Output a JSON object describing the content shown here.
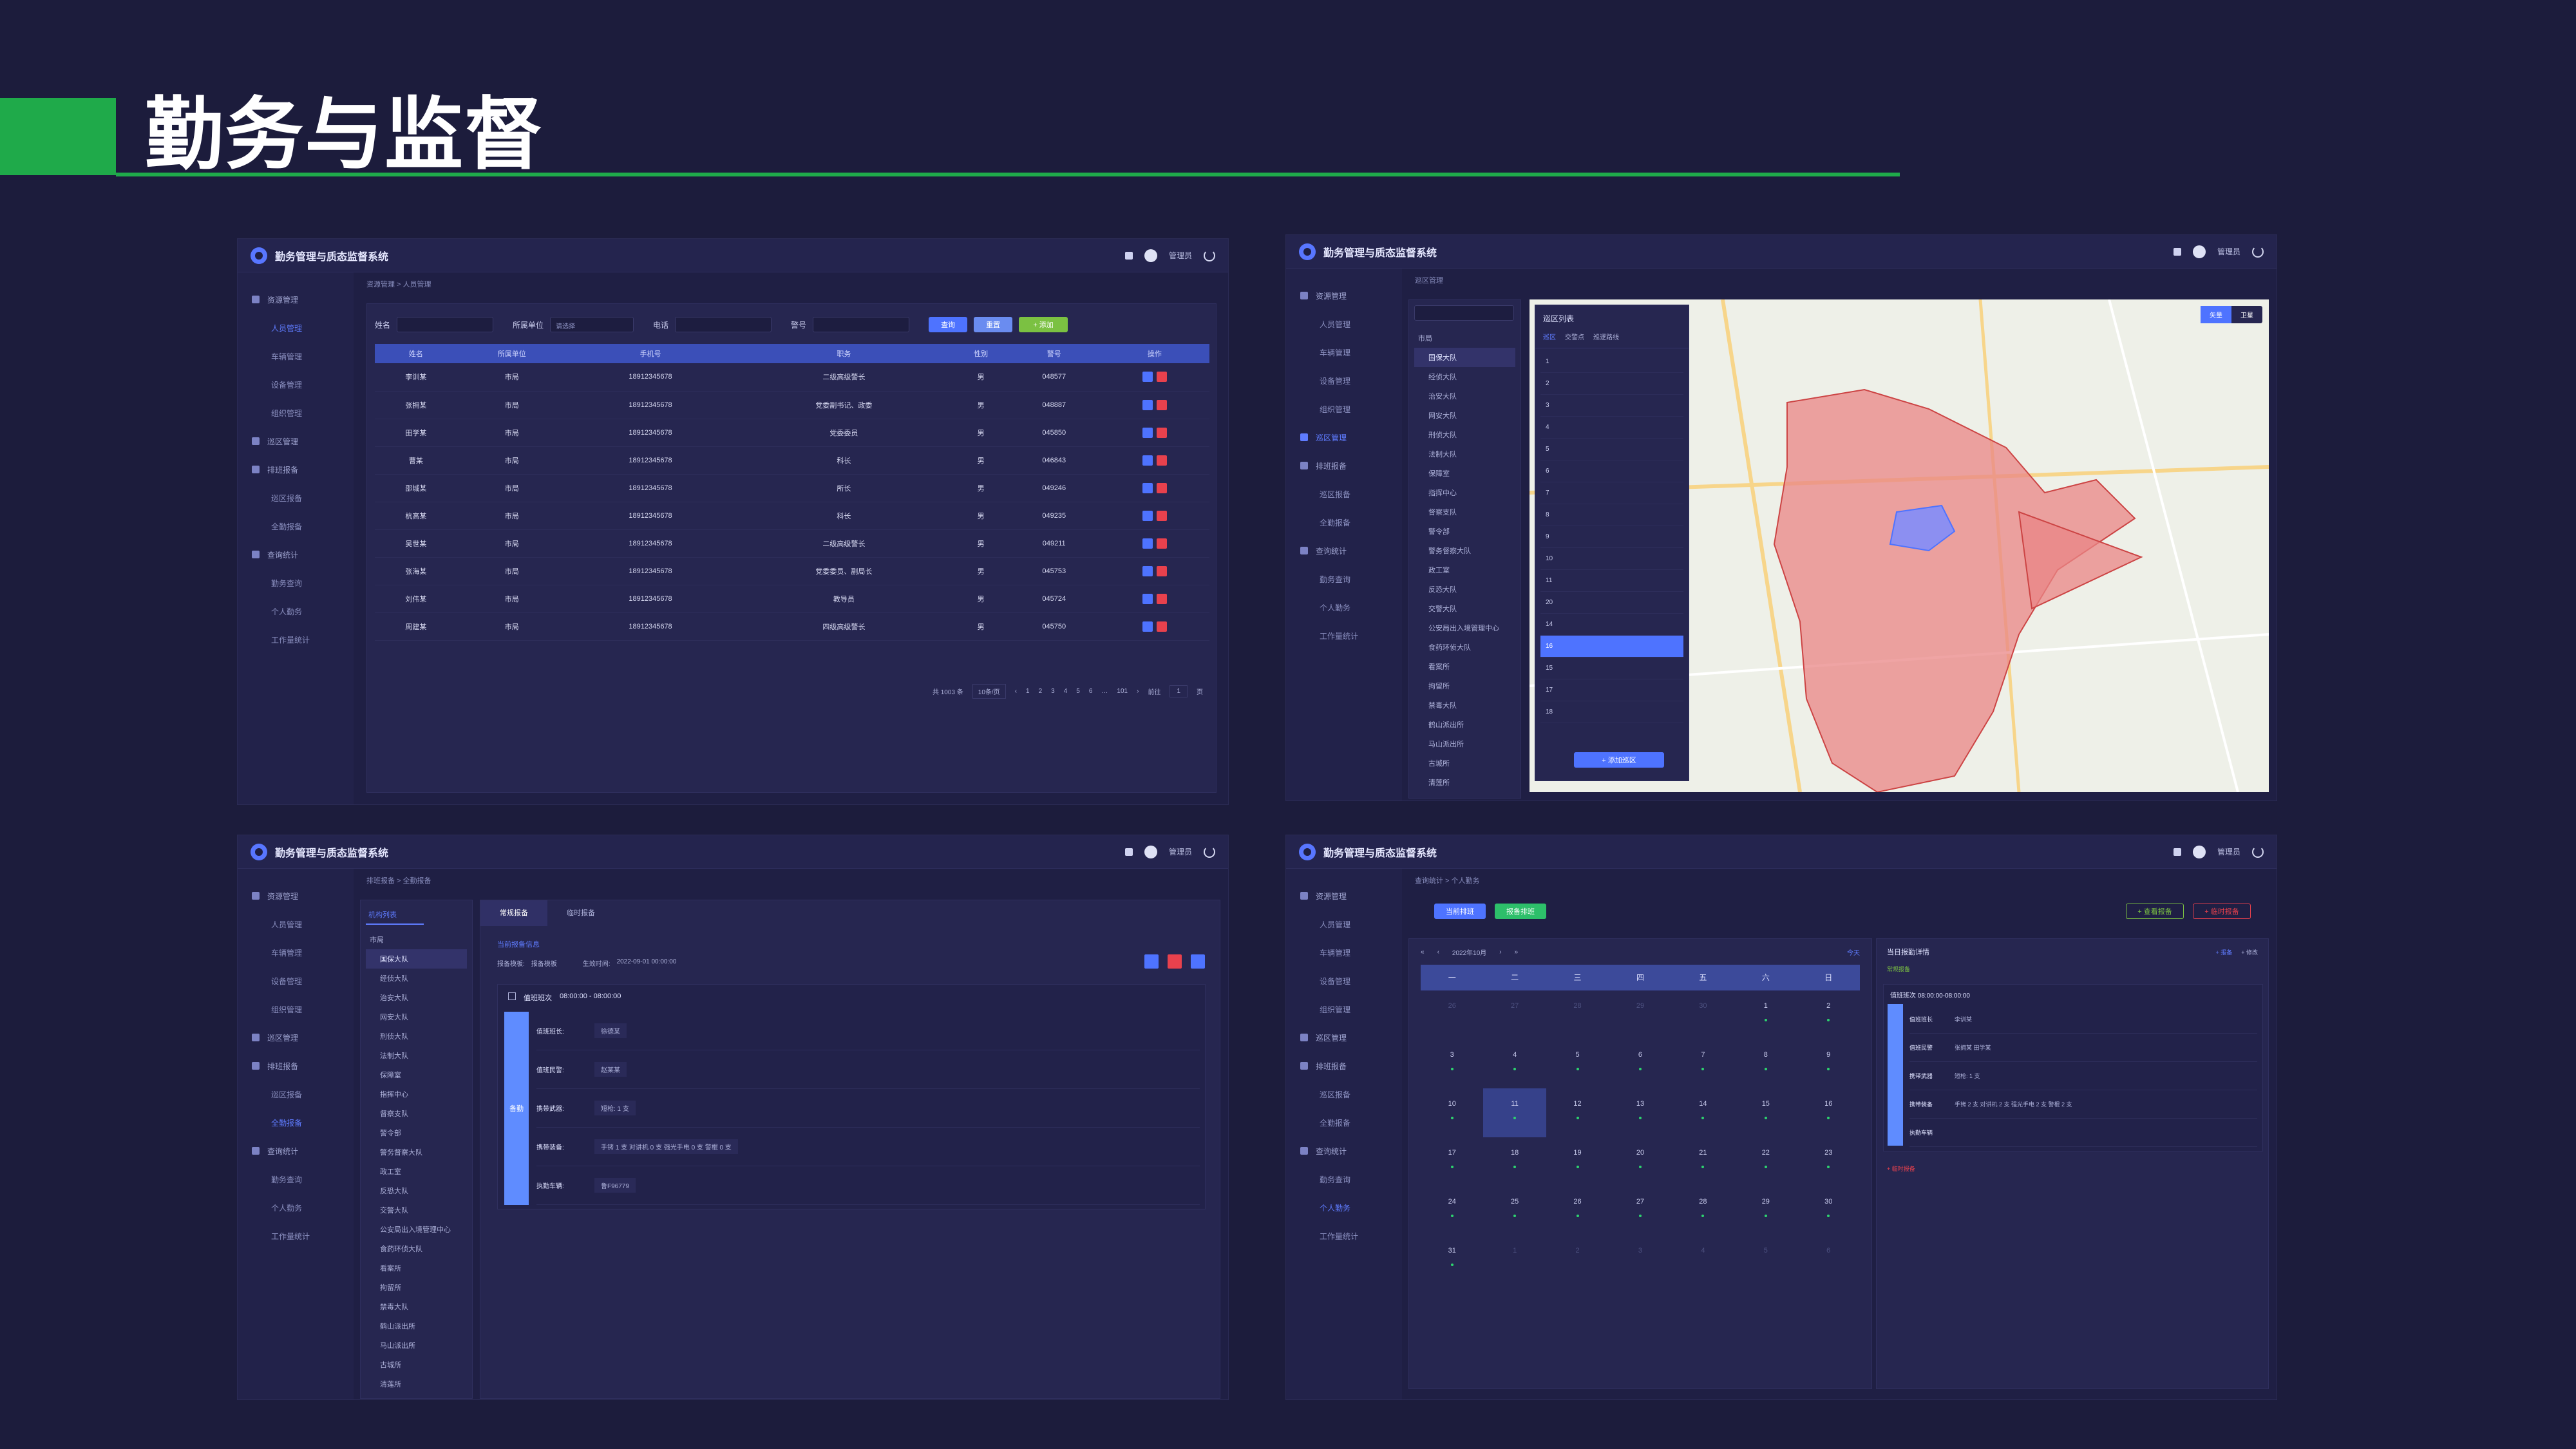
{
  "slide": {
    "title": "勤务与监督"
  },
  "app": {
    "title": "勤务管理与质态监督系统",
    "user": "管理员",
    "icons": [
      "bell-icon",
      "avatar-icon",
      "power-icon"
    ]
  },
  "colors": {
    "background": "#1c1c3c",
    "accent_green": "#1faa4a",
    "primary": "#4e73ff",
    "danger": "#e8414d",
    "success": "#7bc142"
  },
  "screen1": {
    "breadcrumb": "资源管理 > 人员管理",
    "sidebar": [
      "资源管理",
      "人员管理",
      "车辆管理",
      "设备管理",
      "组织管理",
      "巡区管理",
      "排班报备",
      "巡区报备",
      "全勤报备",
      "查询统计",
      "勤务查询",
      "个人勤务",
      "工作量统计"
    ],
    "filters": {
      "name_label": "姓名",
      "unit_label": "所属单位",
      "unit_value": "请选择",
      "phone_label": "电话",
      "badge_label": "警号"
    },
    "buttons": {
      "search": "查询",
      "reset": "重置",
      "add": "+ 添加"
    },
    "table": {
      "headers": [
        "姓名",
        "所属单位",
        "手机号",
        "职务",
        "性别",
        "警号",
        "操作"
      ],
      "rows": [
        [
          "李训某",
          "市局",
          "18912345678",
          "二级高级警长",
          "男",
          "048577"
        ],
        [
          "张拥某",
          "市局",
          "18912345678",
          "党委副书记、政委",
          "男",
          "048887"
        ],
        [
          "田学某",
          "市局",
          "18912345678",
          "党委委员",
          "男",
          "045850"
        ],
        [
          "曹某",
          "市局",
          "18912345678",
          "科长",
          "男",
          "046843"
        ],
        [
          "邵城某",
          "市局",
          "18912345678",
          "所长",
          "男",
          "049246"
        ],
        [
          "杭高某",
          "市局",
          "18912345678",
          "科长",
          "男",
          "049235"
        ],
        [
          "吴世某",
          "市局",
          "18912345678",
          "二级高级警长",
          "男",
          "049211"
        ],
        [
          "张海某",
          "市局",
          "18912345678",
          "党委委员、副局长",
          "男",
          "045753"
        ],
        [
          "刘伟某",
          "市局",
          "18912345678",
          "教导员",
          "男",
          "045724"
        ],
        [
          "周建某",
          "市局",
          "18912345678",
          "四级高级警长",
          "男",
          "045750"
        ]
      ]
    },
    "pagination": {
      "total": "共 1003 条",
      "size": "10条/页",
      "pages": [
        "1",
        "2",
        "3",
        "4",
        "5",
        "6",
        "…",
        "101"
      ],
      "goto": "前往",
      "page": "1",
      "unit": "页"
    }
  },
  "screen2": {
    "breadcrumb": "巡区管理",
    "sidebar": [
      "资源管理",
      "人员管理",
      "车辆管理",
      "设备管理",
      "组织管理",
      "巡区管理",
      "排班报备",
      "巡区报备",
      "全勤报备",
      "查询统计",
      "勤务查询",
      "个人勤务",
      "工作量统计"
    ],
    "tree": [
      "市局",
      "国保大队",
      "经侦大队",
      "治安大队",
      "网安大队",
      "刑侦大队",
      "法制大队",
      "保障室",
      "指挥中心",
      "督察支队",
      "警令部",
      "警务督察大队",
      "政工室",
      "反恐大队",
      "交警大队",
      "公安局出入境管理中心",
      "食药环侦大队",
      "看案所",
      "拘留所",
      "禁毒大队",
      "鹤山派出所",
      "马山派出所",
      "古城所",
      "清莲所"
    ],
    "list": {
      "title": "巡区列表",
      "tabs": [
        "巡区",
        "交警点",
        "巡逻路线"
      ],
      "items": [
        "1",
        "2",
        "3",
        "4",
        "5",
        "6",
        "7",
        "8",
        "9",
        "10",
        "11",
        "20",
        "14",
        "16",
        "15",
        "17",
        "18"
      ],
      "selected": "16",
      "add_button": "+ 添加巡区"
    },
    "map_tools": [
      "矢量",
      "卫星"
    ]
  },
  "screen3": {
    "breadcrumb": "排班报备 > 全勤报备",
    "org_tab": "机构列表",
    "tree": [
      "市局",
      "国保大队",
      "经侦大队",
      "治安大队",
      "网安大队",
      "刑侦大队",
      "法制大队",
      "保障室",
      "指挥中心",
      "督察支队",
      "警令部",
      "警务督察大队",
      "政工室",
      "反恐大队",
      "交警大队",
      "公安局出入境管理中心",
      "食药环侦大队",
      "看案所",
      "拘留所",
      "禁毒大队",
      "鹤山派出所",
      "马山派出所",
      "古城所",
      "清莲所"
    ],
    "tabs": [
      "常规报备",
      "临时报备"
    ],
    "section": "当前报备信息",
    "info": {
      "mode_label": "报备模板:",
      "mode_value": "报备模板",
      "time_label": "生效时间:",
      "time_value": "2022-09-01 00:00:00"
    },
    "shift": {
      "label": "值班班次",
      "time": "08:00:00 - 08:00:00",
      "side": "备勤"
    },
    "fields": [
      {
        "label": "值班班长:",
        "value": "徐德某"
      },
      {
        "label": "值班民警:",
        "value": "赵某某"
      },
      {
        "label": "携带武器:",
        "value": "短枪: 1 支"
      },
      {
        "label": "携带装备:",
        "value": "手铐 1 支  对讲机 0 支  强光手电 0 支  警棍 0 支"
      },
      {
        "label": "执勤车辆:",
        "value": "鲁F96779"
      }
    ]
  },
  "screen4": {
    "breadcrumb": "查询统计 > 个人勤务",
    "buttons": [
      "当前排班",
      "报备排班"
    ],
    "top_right": [
      "+ 查看报备",
      "+ 临时报备"
    ],
    "calendar": {
      "month": "2022年10月",
      "weekdays": [
        "一",
        "二",
        "三",
        "四",
        "五",
        "六",
        "日"
      ],
      "weeks": [
        [
          "26",
          "27",
          "28",
          "29",
          "30",
          "1",
          "2"
        ],
        [
          "3",
          "4",
          "5",
          "6",
          "7",
          "8",
          "9"
        ],
        [
          "10",
          "11",
          "12",
          "13",
          "14",
          "15",
          "16"
        ],
        [
          "17",
          "18",
          "19",
          "20",
          "21",
          "22",
          "23"
        ],
        [
          "24",
          "25",
          "26",
          "27",
          "28",
          "29",
          "30"
        ],
        [
          "31",
          "1",
          "2",
          "3",
          "4",
          "5",
          "6"
        ]
      ],
      "selected": "11",
      "today_label": "今天"
    },
    "detail": {
      "title": "当日报勤详情",
      "actions": [
        "+ 报备",
        "+ 修改"
      ],
      "tag": "常规报备",
      "shift": "值班班次 08:00:00-08:00:00",
      "fields": [
        {
          "label": "值班班长",
          "value": "李训某"
        },
        {
          "label": "值班民警",
          "value": "张拥某  田学某"
        },
        {
          "label": "携带武器",
          "value": "短枪: 1 支"
        },
        {
          "label": "携带装备",
          "value": "手铐 2 支  对讲机 2 支  强光手电 2 支  警棍 2 支"
        },
        {
          "label": "执勤车辆",
          "value": ""
        }
      ],
      "temp": "+ 临时报备"
    }
  }
}
